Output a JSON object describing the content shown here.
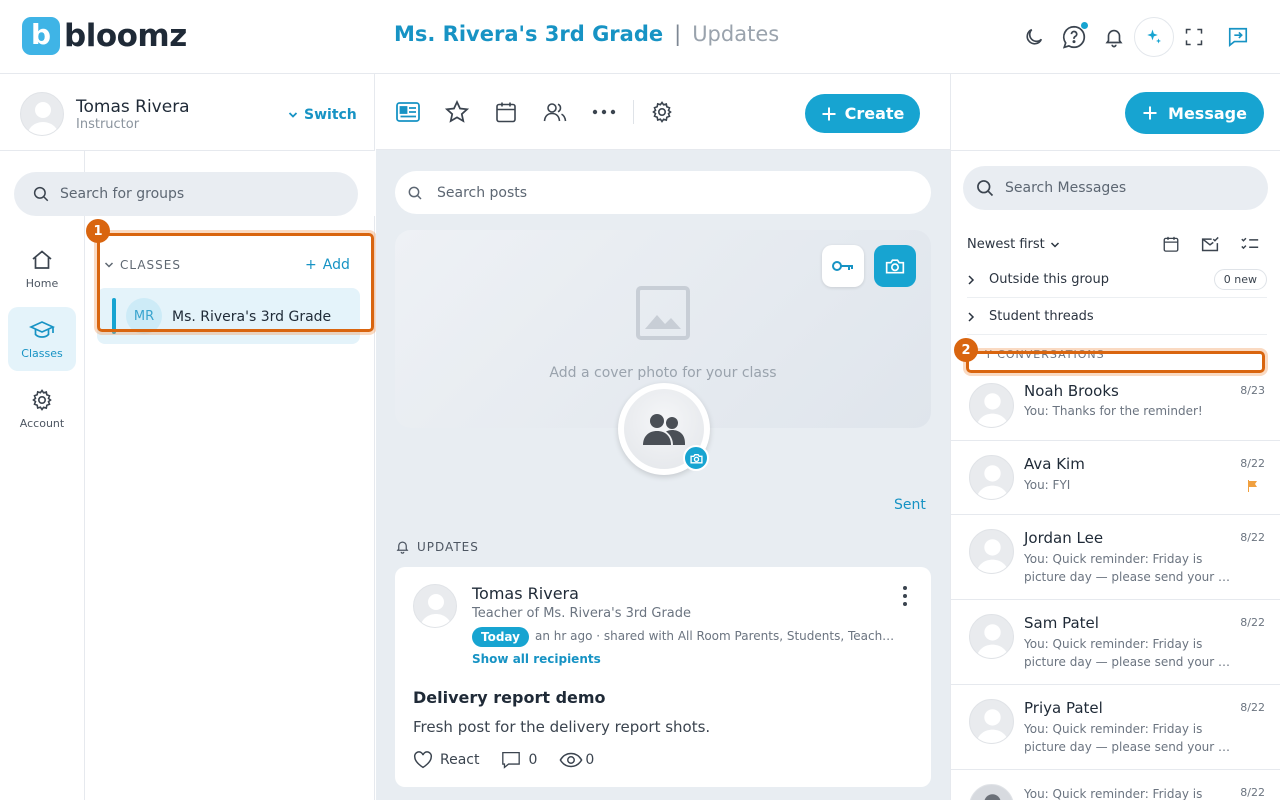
{
  "app": {
    "logo_text": "bloomz",
    "logo_letter": "b",
    "class_name": "Ms. Rivera's 3rd Grade",
    "separator": "|",
    "section": "Updates"
  },
  "header_icons": [
    "moon-icon",
    "help-icon",
    "bell-icon",
    "sparkle-icon",
    "fullscreen-icon",
    "chat-icon"
  ],
  "profile": {
    "name": "Tomas Rivera",
    "role": "Instructor",
    "switch_label": "Switch"
  },
  "group_search": {
    "placeholder": "Search for groups"
  },
  "nav": [
    {
      "label": "Home",
      "icon": "home-icon"
    },
    {
      "label": "Classes",
      "icon": "graduation-cap-icon"
    },
    {
      "label": "Account",
      "icon": "gear-icon"
    }
  ],
  "classes": {
    "header": "CLASSES",
    "add_label": "Add",
    "items": [
      {
        "initials": "MR",
        "name": "Ms. Rivera's 3rd Grade"
      }
    ]
  },
  "annotations": [
    "1",
    "2"
  ],
  "toolbar": {
    "icons": [
      "newsfeed-icon",
      "star-icon",
      "calendar-icon",
      "people-icon",
      "more-icon",
      "settings-icon"
    ],
    "create_label": "Create"
  },
  "post_search": {
    "placeholder": "Search posts"
  },
  "cover": {
    "text": "Add a cover photo for your class"
  },
  "sent_label": "Sent",
  "updates_label": "UPDATES",
  "post": {
    "author": "Tomas Rivera",
    "subtitle": "Teacher of Ms. Rivera's 3rd Grade",
    "badge": "Today",
    "meta": "an hr ago · shared with All Room Parents, Students, Teach…",
    "show_recipients": "Show all recipients",
    "title": "Delivery report demo",
    "body": "Fresh post for the delivery report shots.",
    "react_label": "React",
    "comments": "0",
    "views": "0"
  },
  "messages": {
    "button_label": "Message",
    "search_placeholder": "Search Messages",
    "sort_label": "Newest first",
    "outside_group": "Outside this group",
    "outside_new": "0 new",
    "student_threads": "Student threads",
    "conversations_label": "Y CONVERSATIONS",
    "items": [
      {
        "name": "Noah Brooks",
        "date": "8/23",
        "preview": "You: Thanks for the reminder!",
        "flagged": false
      },
      {
        "name": "Ava Kim",
        "date": "8/22",
        "preview": "You: FYI",
        "flagged": true
      },
      {
        "name": "Jordan Lee",
        "date": "8/22",
        "preview": "You: Quick reminder: Friday is picture day — please send your …",
        "flagged": false
      },
      {
        "name": "Sam Patel",
        "date": "8/22",
        "preview": "You: Quick reminder: Friday is picture day — please send your …",
        "flagged": false
      },
      {
        "name": "Priya Patel",
        "date": "8/22",
        "preview": "You: Quick reminder: Friday is picture day — please send your …",
        "flagged": false
      },
      {
        "name": "",
        "date": "8/22",
        "preview": "You: Quick reminder: Friday is",
        "flagged": false
      }
    ]
  },
  "colors": {
    "accent": "#17a4d1",
    "annotation": "#d9650f",
    "flag": "#f0a040"
  }
}
